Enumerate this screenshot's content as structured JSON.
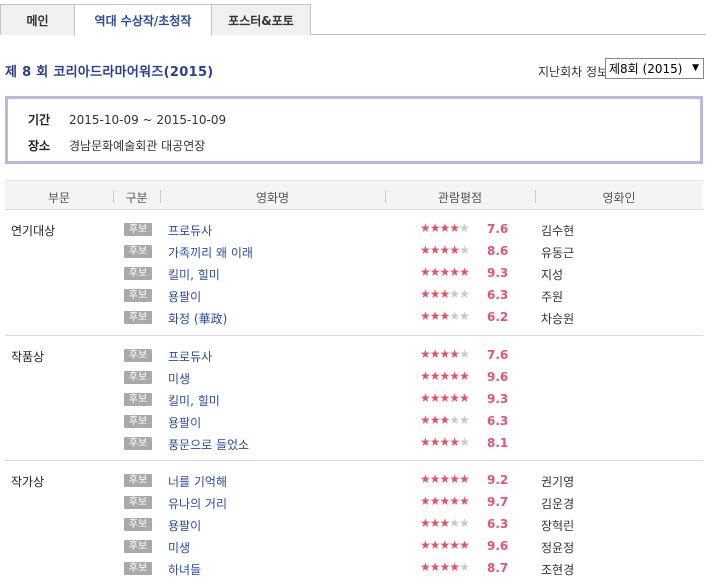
{
  "tabs": [
    {
      "label": "메인",
      "active": false
    },
    {
      "label": "역대 수상작/초청작",
      "active": true
    },
    {
      "label": "포스터&포토",
      "active": false
    }
  ],
  "header": {
    "title": "제 8 회 코리아드라마어워즈(2015)",
    "past_label": "지난회차 정보",
    "past_selected": "제8회 (2015)"
  },
  "info": {
    "period_label": "기간",
    "period_value": "2015-10-09 ~ 2015-10-09",
    "venue_label": "장소",
    "venue_value": "경남문화예술회관 대공연장"
  },
  "table": {
    "headers": [
      "부문",
      "구분",
      "영화명",
      "관람평점",
      "영화인"
    ]
  },
  "groups": [
    {
      "name": "연기대상",
      "rows": [
        {
          "badge": "후보",
          "title": "프로듀사",
          "rating": 4,
          "score": "7.6",
          "person": "김수현"
        },
        {
          "badge": "후보",
          "title": "가족끼리 왜 이래",
          "rating": 4,
          "score": "8.6",
          "person": "유동근"
        },
        {
          "badge": "후보",
          "title": "킬미, 힐미",
          "rating": 5,
          "score": "9.3",
          "person": "지성"
        },
        {
          "badge": "후보",
          "title": "용팔이",
          "rating": 3,
          "score": "6.3",
          "person": "주원"
        },
        {
          "badge": "후보",
          "title": "화정 (華政)",
          "rating": 3,
          "score": "6.2",
          "person": "차승원"
        }
      ]
    },
    {
      "name": "작품상",
      "rows": [
        {
          "badge": "후보",
          "title": "프로듀사",
          "rating": 4,
          "score": "7.6",
          "person": ""
        },
        {
          "badge": "후보",
          "title": "미생",
          "rating": 5,
          "score": "9.6",
          "person": ""
        },
        {
          "badge": "후보",
          "title": "킬미, 힐미",
          "rating": 5,
          "score": "9.3",
          "person": ""
        },
        {
          "badge": "후보",
          "title": "용팔이",
          "rating": 3,
          "score": "6.3",
          "person": ""
        },
        {
          "badge": "후보",
          "title": "풍문으로 들었소",
          "rating": 4,
          "score": "8.1",
          "person": ""
        }
      ]
    },
    {
      "name": "작가상",
      "rows": [
        {
          "badge": "후보",
          "title": "너를 기억해",
          "rating": 5,
          "score": "9.2",
          "person": "권기영"
        },
        {
          "badge": "후보",
          "title": "유나의 거리",
          "rating": 5,
          "score": "9.7",
          "person": "김운경"
        },
        {
          "badge": "후보",
          "title": "용팔이",
          "rating": 3,
          "score": "6.3",
          "person": "장혁린"
        },
        {
          "badge": "후보",
          "title": "미생",
          "rating": 5,
          "score": "9.6",
          "person": "정윤정"
        },
        {
          "badge": "후보",
          "title": "하녀들",
          "rating": 4,
          "score": "8.7",
          "person": "조현경"
        }
      ]
    }
  ]
}
